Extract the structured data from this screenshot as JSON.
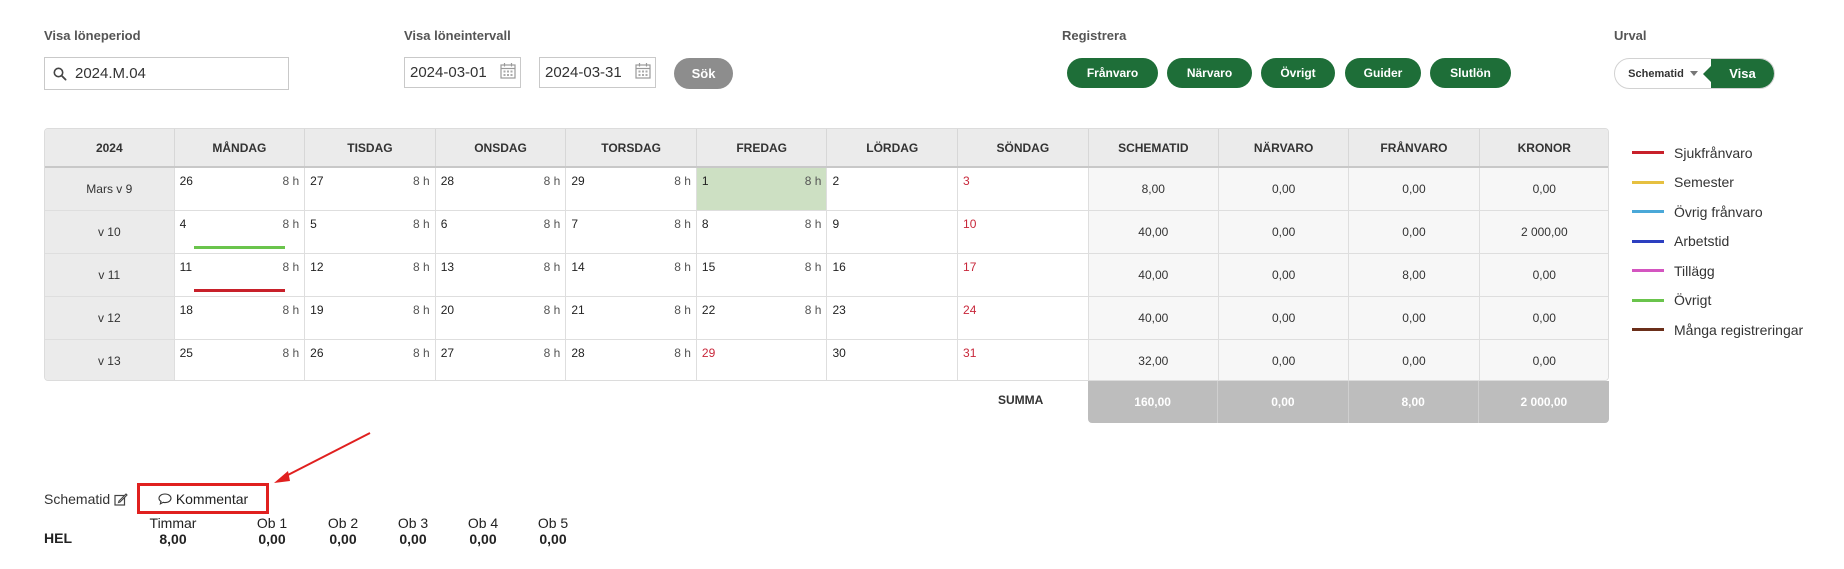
{
  "labels": {
    "loneperiod": "Visa löneperiod",
    "loneintervall": "Visa löneintervall",
    "registrera": "Registrera",
    "urval": "Urval"
  },
  "period_search": {
    "value": "2024.M.04"
  },
  "interval": {
    "from": "2024-03-01",
    "to": "2024-03-31",
    "search_label": "Sök"
  },
  "register_buttons": [
    "Frånvaro",
    "Närvaro",
    "Övrigt",
    "Guider",
    "Slutlön"
  ],
  "urval": {
    "selected": "Schematid",
    "show_label": "Visa"
  },
  "grid": {
    "headers": [
      "2024",
      "MÅNDAG",
      "TISDAG",
      "ONSDAG",
      "TORSDAG",
      "FREDAG",
      "LÖRDAG",
      "SÖNDAG",
      "SCHEMATID",
      "NÄRVARO",
      "FRÅNVARO",
      "KRONOR"
    ],
    "rows": [
      {
        "week": "Mars v 9",
        "days": [
          {
            "d": "26",
            "h": "8 h"
          },
          {
            "d": "27",
            "h": "8 h"
          },
          {
            "d": "28",
            "h": "8 h"
          },
          {
            "d": "29",
            "h": "8 h"
          },
          {
            "d": "1",
            "h": "8 h",
            "highlight": true
          },
          {
            "d": "2",
            "h": ""
          },
          {
            "d": "3",
            "h": "",
            "red": true
          }
        ],
        "values": [
          "8,00",
          "0,00",
          "0,00",
          "0,00"
        ]
      },
      {
        "week": "v 10",
        "days": [
          {
            "d": "4",
            "h": "8 h",
            "bar": "#6ac44c"
          },
          {
            "d": "5",
            "h": "8 h"
          },
          {
            "d": "6",
            "h": "8 h"
          },
          {
            "d": "7",
            "h": "8 h"
          },
          {
            "d": "8",
            "h": "8 h"
          },
          {
            "d": "9",
            "h": ""
          },
          {
            "d": "10",
            "h": "",
            "red": true
          }
        ],
        "values": [
          "40,00",
          "0,00",
          "0,00",
          "2 000,00"
        ]
      },
      {
        "week": "v 11",
        "days": [
          {
            "d": "11",
            "h": "8 h",
            "bar": "#c8202a"
          },
          {
            "d": "12",
            "h": "8 h"
          },
          {
            "d": "13",
            "h": "8 h"
          },
          {
            "d": "14",
            "h": "8 h"
          },
          {
            "d": "15",
            "h": "8 h"
          },
          {
            "d": "16",
            "h": ""
          },
          {
            "d": "17",
            "h": "",
            "red": true
          }
        ],
        "values": [
          "40,00",
          "0,00",
          "8,00",
          "0,00"
        ]
      },
      {
        "week": "v 12",
        "days": [
          {
            "d": "18",
            "h": "8 h"
          },
          {
            "d": "19",
            "h": "8 h"
          },
          {
            "d": "20",
            "h": "8 h"
          },
          {
            "d": "21",
            "h": "8 h"
          },
          {
            "d": "22",
            "h": "8 h"
          },
          {
            "d": "23",
            "h": ""
          },
          {
            "d": "24",
            "h": "",
            "red": true
          }
        ],
        "values": [
          "40,00",
          "0,00",
          "0,00",
          "0,00"
        ]
      },
      {
        "week": "v 13",
        "days": [
          {
            "d": "25",
            "h": "8 h"
          },
          {
            "d": "26",
            "h": "8 h"
          },
          {
            "d": "27",
            "h": "8 h"
          },
          {
            "d": "28",
            "h": "8 h"
          },
          {
            "d": "29",
            "h": "",
            "red": true
          },
          {
            "d": "30",
            "h": ""
          },
          {
            "d": "31",
            "h": "",
            "red": true
          }
        ],
        "values": [
          "32,00",
          "0,00",
          "0,00",
          "0,00"
        ]
      }
    ],
    "summa_label": "SUMMA",
    "summa": [
      "160,00",
      "0,00",
      "8,00",
      "2 000,00"
    ]
  },
  "legend": [
    {
      "label": "Sjukfrånvaro",
      "color": "#c8202a"
    },
    {
      "label": "Semester",
      "color": "#e6c040"
    },
    {
      "label": "Övrig frånvaro",
      "color": "#4aa8d8"
    },
    {
      "label": "Arbetstid",
      "color": "#2c3fc0"
    },
    {
      "label": "Tillägg",
      "color": "#d455c0"
    },
    {
      "label": "Övrigt",
      "color": "#6ac44c"
    },
    {
      "label": "Många registreringar",
      "color": "#6b2f1a"
    }
  ],
  "bottom": {
    "schematid_label": "Schematid",
    "kommentar_label": "Kommentar",
    "row_label": "HEL",
    "columns": [
      {
        "h": "Timmar",
        "v": "8,00"
      },
      {
        "h": "Ob 1",
        "v": "0,00"
      },
      {
        "h": "Ob 2",
        "v": "0,00"
      },
      {
        "h": "Ob 3",
        "v": "0,00"
      },
      {
        "h": "Ob 4",
        "v": "0,00"
      },
      {
        "h": "Ob 5",
        "v": "0,00"
      }
    ]
  },
  "colors": {
    "accent": "#1e6e38",
    "highlight_day": "#cde0c3",
    "annotation": "#e0201f"
  }
}
